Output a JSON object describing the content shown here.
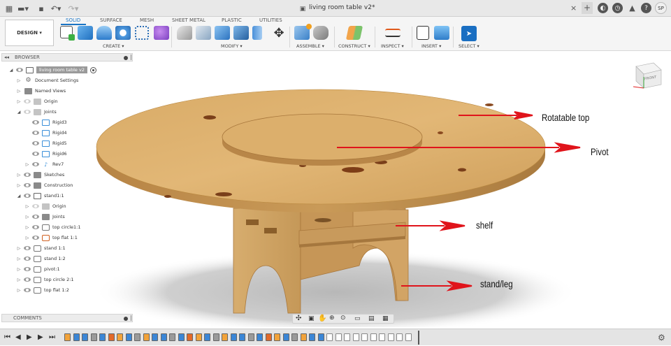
{
  "topbar": {
    "title": "living room table v2*",
    "close_glyph": "×",
    "user_initials": "SP",
    "icons": [
      "grid-icon",
      "file-icon",
      "save-icon",
      "undo-icon",
      "redo-icon",
      "doc-icon",
      "close-icon",
      "new-tab-icon",
      "extensions-icon",
      "job-status-icon",
      "notifications-icon",
      "help-icon"
    ]
  },
  "ribbon": {
    "workspace": "DESIGN ▾",
    "tabs": [
      "SOLID",
      "SURFACE",
      "MESH",
      "SHEET METAL",
      "PLASTIC",
      "UTILITIES"
    ],
    "active_tab": "SOLID",
    "groups": [
      "CREATE ▾",
      "MODIFY ▾",
      "ASSEMBLE ▾",
      "CONSTRUCT ▾",
      "INSPECT ▾",
      "INSERT ▾",
      "SELECT ▾"
    ],
    "accent": "#1a74c4"
  },
  "browser": {
    "header": "BROWSER",
    "collapse_glyph": "◂◂",
    "root": "living room table v2",
    "items": [
      {
        "label": "Document Settings"
      },
      {
        "label": "Named Views"
      },
      {
        "label": "Origin"
      },
      {
        "label": "Joints"
      },
      {
        "label": "Rigid3"
      },
      {
        "label": "Rigid4"
      },
      {
        "label": "Rigid5"
      },
      {
        "label": "Rigid6"
      },
      {
        "label": "Rev7"
      },
      {
        "label": "Sketches"
      },
      {
        "label": "Construction"
      },
      {
        "label": "stand1:1"
      },
      {
        "label": "Origin"
      },
      {
        "label": "Joints"
      },
      {
        "label": "top circle1:1"
      },
      {
        "label": "top flat 1:1"
      },
      {
        "label": "stand 1:1"
      },
      {
        "label": "stand 1:2"
      },
      {
        "label": "pivot:1"
      },
      {
        "label": "top circle 2:1"
      },
      {
        "label": "top flat 1:2"
      }
    ]
  },
  "comments": {
    "header": "COMMENTS"
  },
  "viewcube": {
    "face": "FRONT"
  },
  "annotations": {
    "rotatable_top": "Rotatable top",
    "pivot": "Pivot",
    "shelf": "shelf",
    "stand_leg": "stand/leg",
    "arrow_color": "#e0141b"
  },
  "timeline": {
    "controls": [
      "first",
      "previous",
      "play",
      "next",
      "last"
    ]
  }
}
